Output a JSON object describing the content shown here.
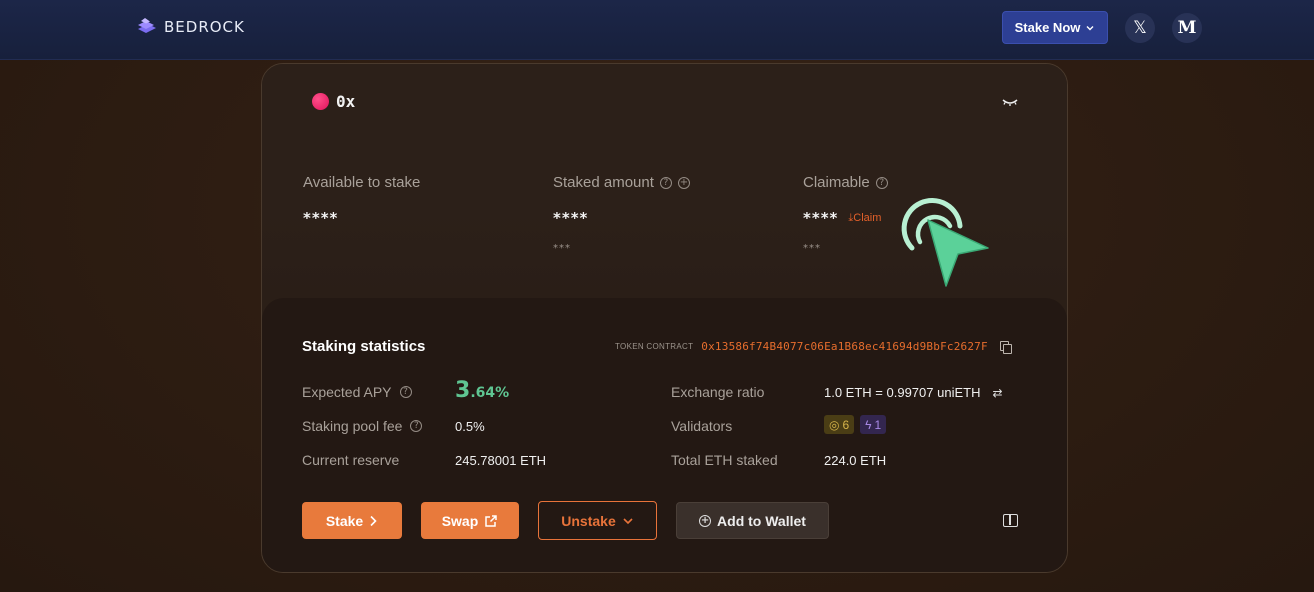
{
  "header": {
    "brand": "BEDROCK",
    "stake_now_label": "Stake Now",
    "social": {
      "x_label": "𝕏",
      "medium_label": "M"
    }
  },
  "wallet": {
    "address": "0x"
  },
  "balances": {
    "available": {
      "label": "Available to stake",
      "value": "****"
    },
    "staked": {
      "label": "Staked amount",
      "value": "****",
      "sub": "***"
    },
    "claimable": {
      "label": "Claimable",
      "value": "****",
      "sub": "***",
      "claim_label": "Claim"
    }
  },
  "statistics": {
    "title": "Staking statistics",
    "contract_label": "TOKEN CONTRACT",
    "contract_address": "0x13586f74B4077c06Ea1B68ec41694d9BbFc2627F",
    "rows": {
      "apy": {
        "label": "Expected APY",
        "value_int": "3",
        "value_dec": ".64%"
      },
      "pool_fee": {
        "label": "Staking pool fee",
        "value": "0.5%"
      },
      "reserve": {
        "label": "Current reserve",
        "value": "245.78001 ETH"
      },
      "exchange": {
        "label": "Exchange ratio",
        "value": "1.0 ETH = 0.99707 uniETH"
      },
      "validators": {
        "label": "Validators",
        "count_a": "6",
        "count_b": "1"
      },
      "total_staked": {
        "label": "Total ETH staked",
        "value": "224.0 ETH"
      }
    }
  },
  "actions": {
    "stake": "Stake",
    "swap": "Swap",
    "unstake": "Unstake",
    "add_wallet": "Add to Wallet"
  },
  "colors": {
    "accent_orange": "#e87a3c",
    "apy_green": "#5fc592",
    "header_bg": "#1c2648",
    "stake_now_bg": "#2d3f94"
  },
  "icons": [
    "bedrock-logo-icon",
    "chevron-down-icon",
    "x-logo-icon",
    "medium-logo-icon",
    "eye-closed-icon",
    "help-icon",
    "plus-circle-icon",
    "download-icon",
    "copy-icon",
    "swap-arrows-icon",
    "check-badge-icon",
    "bolt-icon",
    "chevron-right-icon",
    "external-link-icon",
    "book-icon",
    "cursor-click-icon"
  ]
}
